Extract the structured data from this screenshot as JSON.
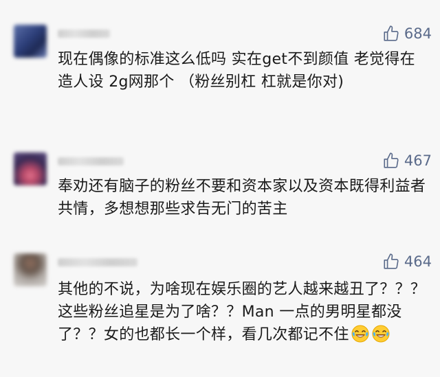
{
  "comments": [
    {
      "likes": "684",
      "text": "现在偶像的标准这么低吗 实在get不到颜值 老觉得在造人设 2g网那个 （粉丝别杠 杠就是你对)"
    },
    {
      "likes": "467",
      "text": "奉劝还有脑子的粉丝不要和资本家以及资本既得利益者共情，多想想那些求告无门的苦主"
    },
    {
      "likes": "464",
      "text": "其他的不说，为啥现在娱乐圈的艺人越来越丑了？？？这些粉丝追星是为了啥？？Man 一点的男明星都没了？？女的也都长一个样，看几次都记不住",
      "emojis": [
        "laughing-tears-emoji",
        "laughing-tears-emoji"
      ]
    }
  ]
}
